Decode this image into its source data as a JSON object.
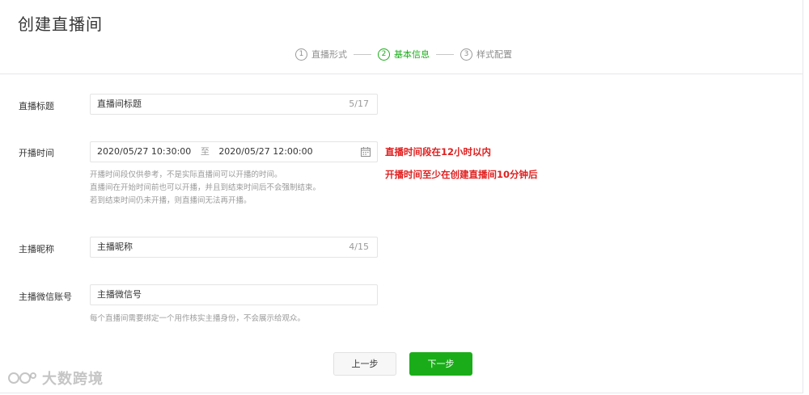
{
  "page_title": "创建直播间",
  "steps": [
    {
      "num": "1",
      "label": "直播形式",
      "active": false
    },
    {
      "num": "2",
      "label": "基本信息",
      "active": true
    },
    {
      "num": "3",
      "label": "样式配置",
      "active": false
    }
  ],
  "form": {
    "title": {
      "label": "直播标题",
      "value": "直播间标题",
      "count": "5/17"
    },
    "time": {
      "label": "开播时间",
      "start": "2020/05/27 10:30:00",
      "separator": "至",
      "end": "2020/05/27 12:00:00",
      "help": [
        "开播时间段仅供参考，不是实际直播间可以开播的时间。",
        "直播间在开始时间前也可以开播，并且到结束时间后不会强制结束。",
        "若到结束时间仍未开播，则直播间无法再开播。"
      ]
    },
    "nickname": {
      "label": "主播昵称",
      "value": "主播昵称",
      "count": "4/15"
    },
    "wechat": {
      "label": "主播微信账号",
      "value": "主播微信号",
      "help": "每个直播间需要绑定一个用作核实主播身份，不会展示给观众。"
    }
  },
  "annotations": {
    "note1": "直播时间段在12小时以内",
    "note2": "开播时间至少在创建直播间10分钟后",
    "color": "#e01e1e"
  },
  "buttons": {
    "prev": "上一步",
    "next": "下一步"
  },
  "watermark": "大数跨境",
  "colors": {
    "accent": "#1aad19",
    "text": "#353535",
    "muted": "#9a9a9a"
  }
}
